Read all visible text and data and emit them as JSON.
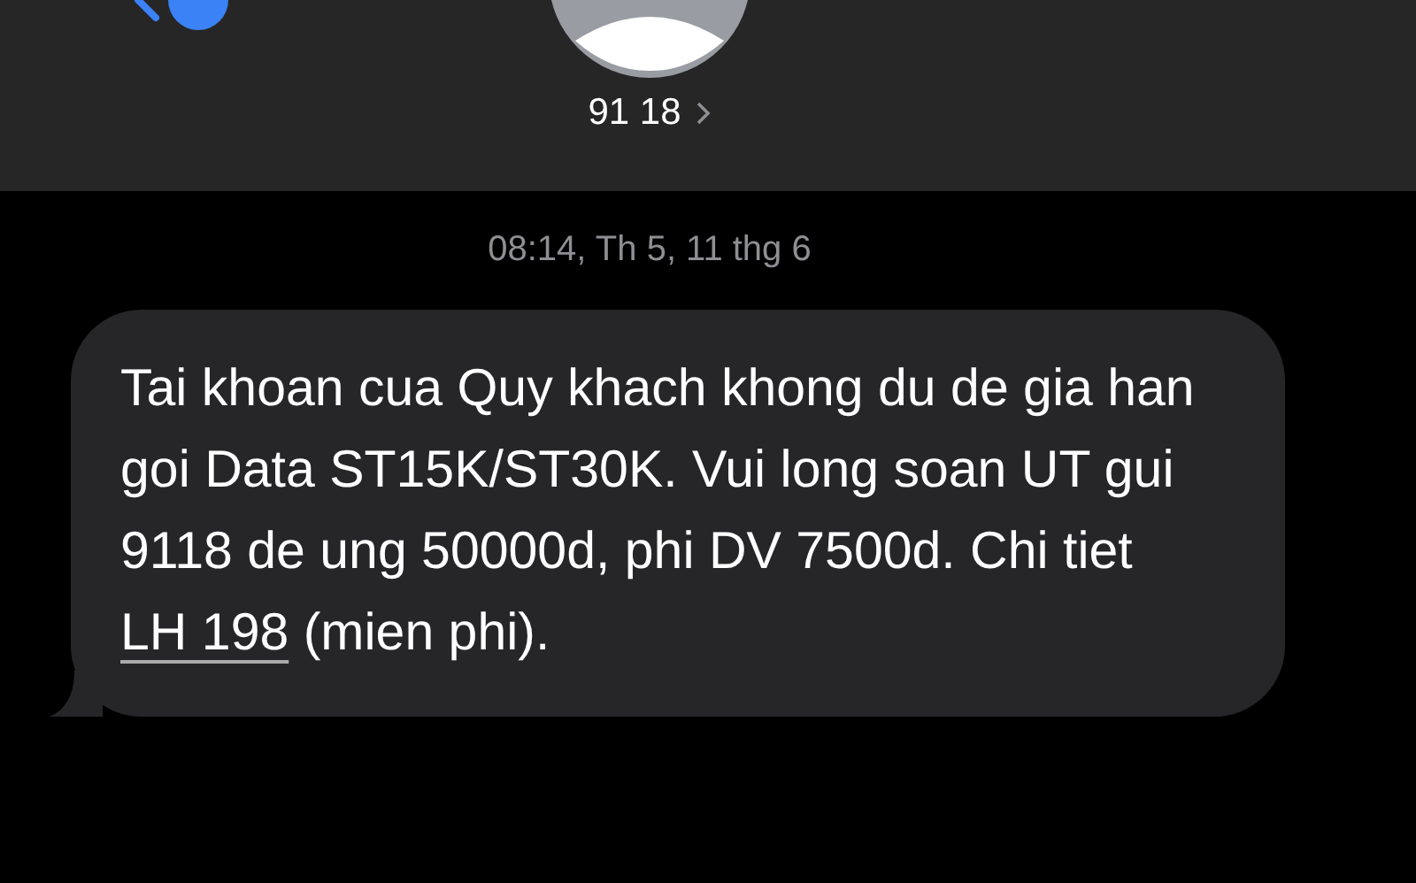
{
  "header": {
    "contact_name": "91 18"
  },
  "timestamp": "08:14, Th 5, 11 thg 6",
  "message": {
    "segments": [
      {
        "kind": "plain",
        "text": "Tai khoan cua Quy khach khong du de gia han goi Data ST15K/ST30K. Vui long soan UT gui 9118 de ung 50000d, phi DV 7500d. Chi tiet "
      },
      {
        "kind": "link",
        "text": "LH 198"
      },
      {
        "kind": "plain",
        "text": " (mien phi)."
      }
    ]
  }
}
